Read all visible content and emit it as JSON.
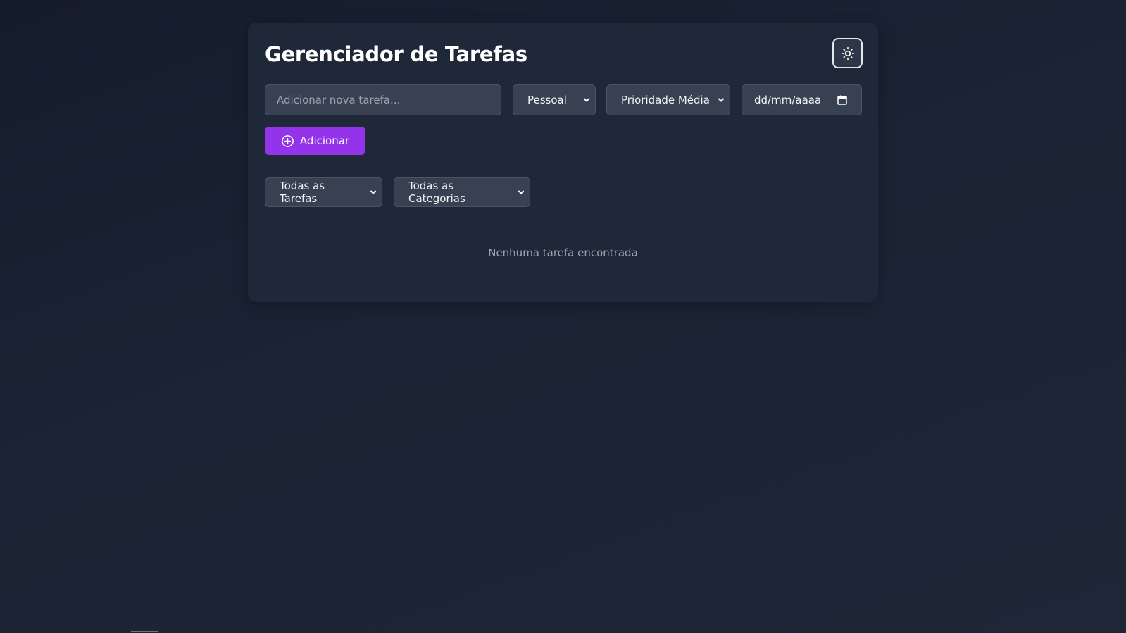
{
  "app": {
    "title": "Gerenciador de Tarefas",
    "theme_toggle_icon": "sun-icon"
  },
  "form": {
    "task_placeholder": "Adicionar nova tarefa...",
    "category_selected": "Pessoal",
    "priority_selected": "Prioridade Média",
    "date_placeholder": "dd/mm/aaaa",
    "add_label": "Adicionar"
  },
  "filters": {
    "status_selected": "Todas as Tarefas",
    "category_selected": "Todas as Categorias"
  },
  "list": {
    "empty_message": "Nenhuma tarefa encontrada"
  },
  "colors": {
    "accent": "#9333ea",
    "card_bg": "#1f2838",
    "input_bg": "#374151"
  }
}
